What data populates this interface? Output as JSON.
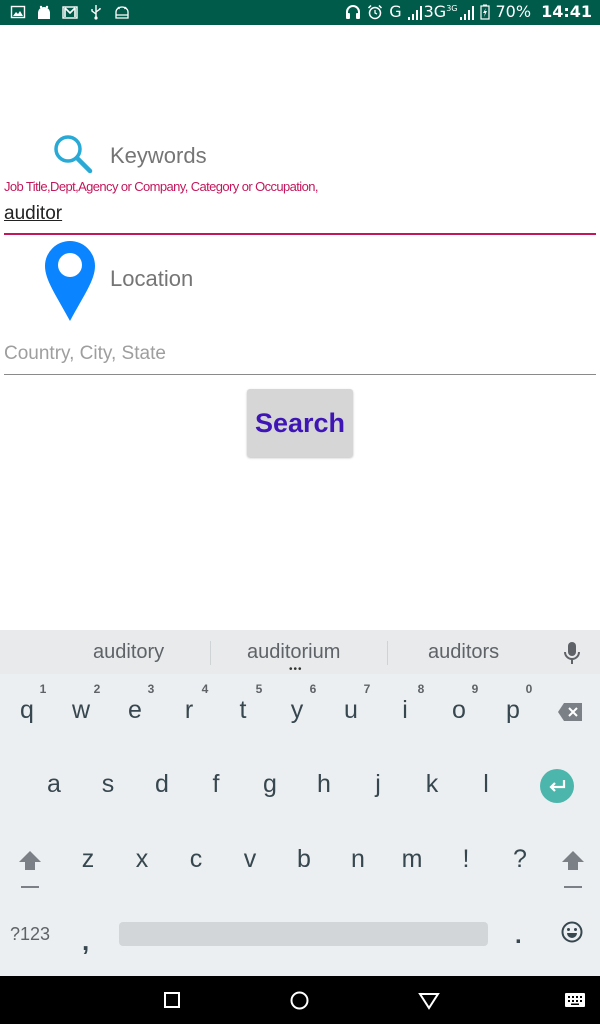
{
  "status_bar": {
    "left_icons": [
      "gallery-icon",
      "app-notification-icon",
      "gmail-icon",
      "usb-icon",
      "android-debug-icon"
    ],
    "right_icons": [
      "headset-icon",
      "alarm-icon",
      "network-g-icon",
      "signal-icon",
      "signal-3g-icon",
      "battery-icon"
    ],
    "network_1": "G",
    "network_2": "3G",
    "network_3_sup": "3G",
    "battery_percent": "70%",
    "time": "14:41"
  },
  "form": {
    "keywords_label": "Keywords",
    "keywords_hint": "Job Title,Dept,Agency or Company, Category or Occupation,",
    "keywords_value": "auditor",
    "location_label": "Location",
    "location_placeholder": "Country, City, State",
    "location_value": "",
    "search_button": "Search"
  },
  "colors": {
    "status_bar": "#005b4a",
    "accent_pink": "#c2185b",
    "search_text": "#3f16b5",
    "search_icon": "#29a9d6",
    "pin_icon": "#0a84ff",
    "enter_key": "#4db6ac"
  },
  "keyboard": {
    "suggestions": [
      "auditory",
      "auditorium",
      "auditors"
    ],
    "row1": [
      "q",
      "w",
      "e",
      "r",
      "t",
      "y",
      "u",
      "i",
      "o",
      "p"
    ],
    "row1_hints": [
      "1",
      "2",
      "3",
      "4",
      "5",
      "6",
      "7",
      "8",
      "9",
      "0"
    ],
    "row2": [
      "a",
      "s",
      "d",
      "f",
      "g",
      "h",
      "j",
      "k",
      "l"
    ],
    "row3": [
      "z",
      "x",
      "c",
      "v",
      "b",
      "n",
      "m",
      "!",
      "?"
    ],
    "symbols_key": "?123",
    "comma": ",",
    "period": "."
  },
  "nav_bar": {
    "buttons": [
      "recents",
      "home",
      "back",
      "keyboard-switch"
    ]
  }
}
